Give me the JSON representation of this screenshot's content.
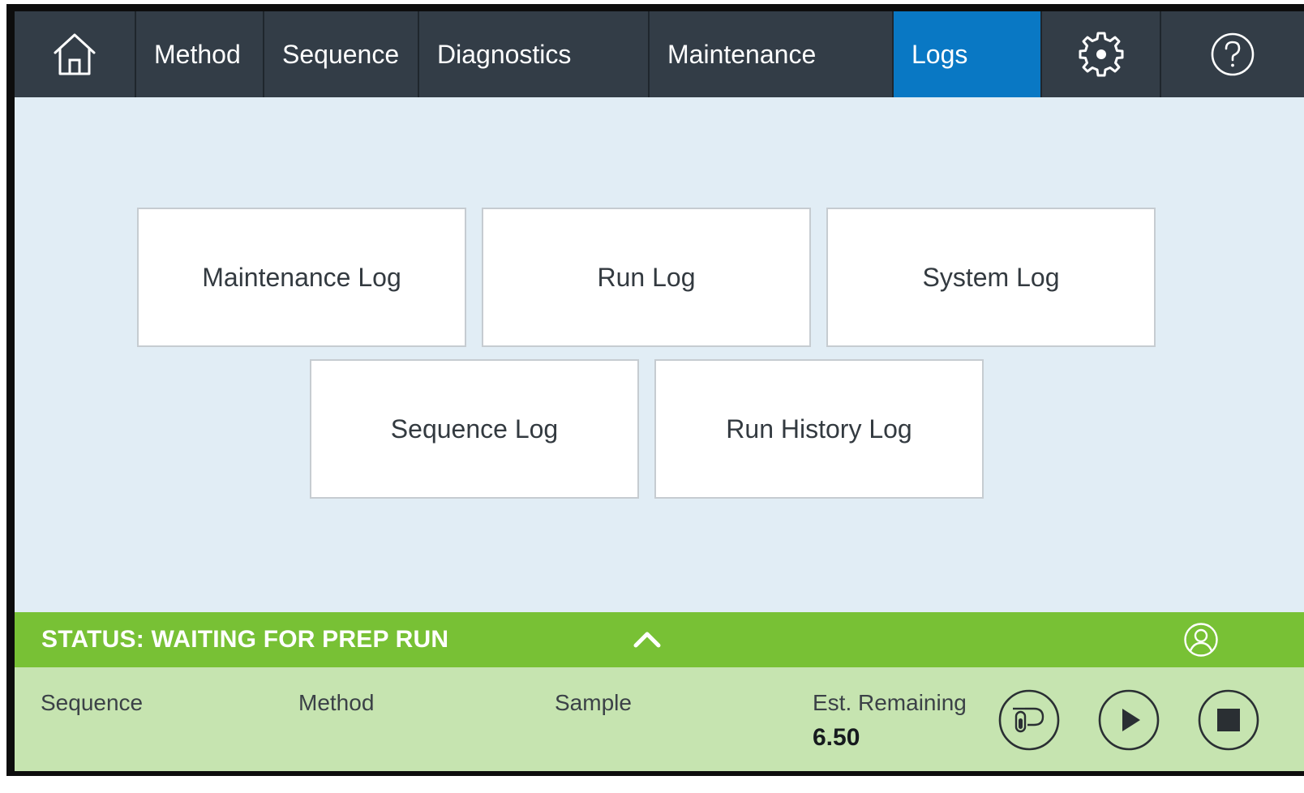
{
  "nav": {
    "home_icon": "home-icon",
    "tabs": [
      {
        "label": "Method"
      },
      {
        "label": "Sequence"
      },
      {
        "label": "Diagnostics"
      },
      {
        "label": "Maintenance"
      },
      {
        "label": "Logs",
        "active": true
      }
    ],
    "settings_icon": "gear-icon",
    "help_icon": "help-icon",
    "active_color": "#0978c4",
    "background_color": "#333d47"
  },
  "logs": {
    "tiles": [
      {
        "label": "Maintenance Log"
      },
      {
        "label": "Run Log"
      },
      {
        "label": "System Log"
      },
      {
        "label": "Sequence Log"
      },
      {
        "label": "Run History Log"
      }
    ]
  },
  "status": {
    "text": "STATUS: WAITING FOR PREP RUN",
    "color": "#78c135",
    "toggle_icon": "chevron-up-icon",
    "user_icon": "user-icon"
  },
  "info": {
    "sequence_label": "Sequence",
    "method_label": "Method",
    "sample_label": "Sample",
    "remaining_label": "Est. Remaining",
    "remaining_value": "6.50",
    "buttons": [
      "prep-icon",
      "play-icon",
      "stop-icon"
    ]
  }
}
